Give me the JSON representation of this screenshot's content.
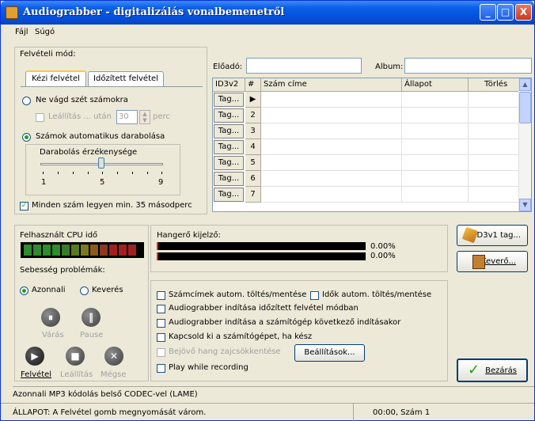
{
  "window": {
    "title": "Audiograbber - digitalizálás vonalbemenetről"
  },
  "titlebar_buttons": {
    "min": "_",
    "max": "□",
    "close": "X"
  },
  "menu": [
    "Fájl",
    "Súgó"
  ],
  "recording_mode": {
    "group_label": "Felvételi mód:",
    "tabs": [
      "Kézi felvétel",
      "Időzített felvétel"
    ],
    "radio_no_split": "Ne vágd szét számokra",
    "stop_after_checkbox": "Leállítás ... után",
    "stop_after_value": "30",
    "stop_after_unit": "perc",
    "radio_auto_split": "Számok automatikus darabolása",
    "sensitivity_label": "Darabolás érzékenysége",
    "sensitivity_value": 5,
    "scale_labels": [
      "1",
      "5",
      "9"
    ],
    "min_length_checkbox": "Minden szám legyen min. 35 másodperc"
  },
  "artist": {
    "label": "Előadó:",
    "value": ""
  },
  "album": {
    "label": "Album:",
    "value": ""
  },
  "track_table": {
    "headers": [
      "ID3v2",
      "#",
      "Szám címe",
      "Állapot",
      "Törlés"
    ],
    "tag_label": "Tag...",
    "rows": [
      {
        "num": "▶"
      },
      {
        "num": "2"
      },
      {
        "num": "3"
      },
      {
        "num": "4"
      },
      {
        "num": "5"
      },
      {
        "num": "6"
      },
      {
        "num": "7"
      }
    ]
  },
  "cpu": {
    "label": "Felhasznált CPU idő"
  },
  "speed_problems_label": "Sebesség problémák:",
  "speed_options": [
    "Azonnali",
    "Keverés"
  ],
  "volume": {
    "label": "Hangerő kijelző:",
    "values": [
      "0.00%",
      "0.00%"
    ]
  },
  "control_buttons": {
    "pause_all": "Várás",
    "pause": "Pause",
    "record": "Felvétel",
    "stop": "Leállítás",
    "cancel": "Mégse"
  },
  "options": {
    "autoload_titles": "Számcímek autom. töltés/mentése",
    "autoload_times": "Idők autom. töltés/mentése",
    "start_timer_mode": "Audiograbber indítása időzített felvétel módban",
    "start_next_boot": "Audiograbber indítása a számítógép következő indításakor",
    "shutdown_when_done": "Kapcsold ki a számítógépet, ha kész",
    "reduce_incoming": "Bejövő hang zajcsökkentése",
    "settings_button": "Beállítások...",
    "play_while_recording": "Play while recording"
  },
  "side_buttons": {
    "id3v1": "ID3v1 tag...",
    "mixer": "Keverő...",
    "close": "Bezárás"
  },
  "status": {
    "encoding": "Azonnali MP3 kódolás belső CODEC-vel (LAME)",
    "state": "ÁLLAPOT: A Felvétel gomb megnyomását várom.",
    "time": "00:00, Szám 1"
  },
  "colors": {
    "title_gradient": "#0550DC",
    "cpu_green": "#2E8B2E",
    "cpu_red": "#A02020",
    "volume_red": "#D03020",
    "record_green": "#21A121"
  }
}
